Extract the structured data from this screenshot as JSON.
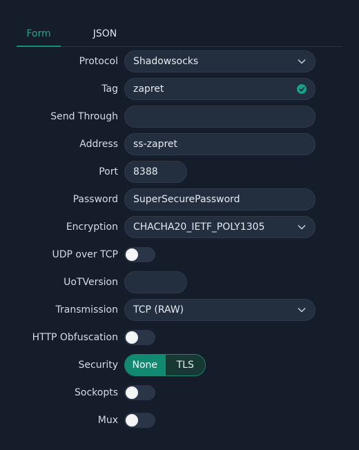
{
  "tabs": [
    {
      "label": "Form",
      "active": true
    },
    {
      "label": "JSON",
      "active": false
    }
  ],
  "fields": {
    "protocol": {
      "label": "Protocol",
      "value": "Shadowsocks",
      "icon": "chevron-down-icon"
    },
    "tag": {
      "label": "Tag",
      "value": "zapret",
      "icon": "check-circle-icon"
    },
    "send_through": {
      "label": "Send Through",
      "value": ""
    },
    "address": {
      "label": "Address",
      "value": "ss-zapret"
    },
    "port": {
      "label": "Port",
      "value": "8388"
    },
    "password": {
      "label": "Password",
      "value": "SuperSecurePassword"
    },
    "encryption": {
      "label": "Encryption",
      "value": "CHACHA20_IETF_POLY1305",
      "icon": "chevron-down-icon"
    },
    "udp_over_tcp": {
      "label": "UDP over TCP",
      "enabled": false
    },
    "uot_version": {
      "label": "UoTVersion",
      "value": ""
    },
    "transmission": {
      "label": "Transmission",
      "value": "TCP (RAW)",
      "icon": "chevron-down-icon"
    },
    "http_obfuscation": {
      "label": "HTTP Obfuscation",
      "enabled": false
    },
    "security": {
      "label": "Security",
      "options": [
        "None",
        "TLS"
      ],
      "selected": "None"
    },
    "sockopts": {
      "label": "Sockopts",
      "enabled": false
    },
    "mux": {
      "label": "Mux",
      "enabled": false
    }
  },
  "colors": {
    "background": "#151d2a",
    "field_bg": "#232e3f",
    "accent": "#17907a",
    "active_tab_text": "#22a488"
  }
}
